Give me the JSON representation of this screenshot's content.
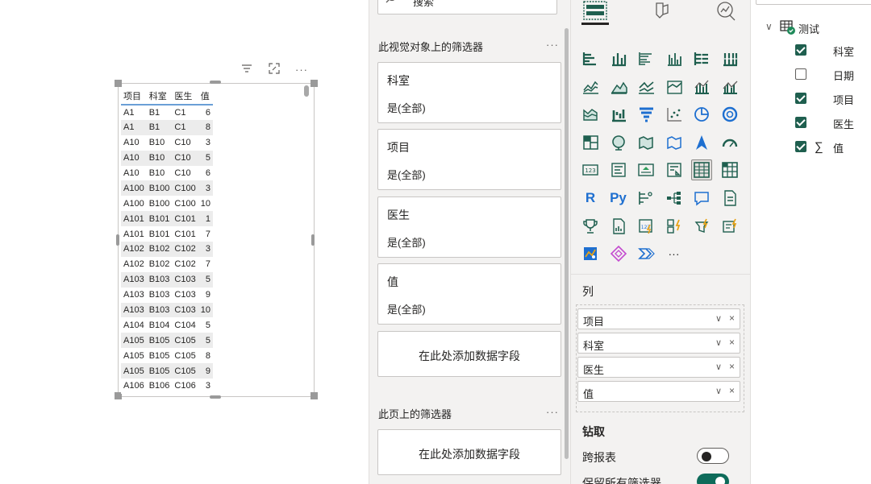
{
  "visual": {
    "columns": [
      "项目",
      "科室",
      "医生",
      "值"
    ],
    "rows": [
      [
        "A1",
        "B1",
        "C1",
        "6"
      ],
      [
        "A1",
        "B1",
        "C1",
        "8"
      ],
      [
        "A10",
        "B10",
        "C10",
        "3"
      ],
      [
        "A10",
        "B10",
        "C10",
        "5"
      ],
      [
        "A10",
        "B10",
        "C10",
        "6"
      ],
      [
        "A100",
        "B100",
        "C100",
        "3"
      ],
      [
        "A100",
        "B100",
        "C100",
        "10"
      ],
      [
        "A101",
        "B101",
        "C101",
        "1"
      ],
      [
        "A101",
        "B101",
        "C101",
        "7"
      ],
      [
        "A102",
        "B102",
        "C102",
        "3"
      ],
      [
        "A102",
        "B102",
        "C102",
        "7"
      ],
      [
        "A103",
        "B103",
        "C103",
        "5"
      ],
      [
        "A103",
        "B103",
        "C103",
        "9"
      ],
      [
        "A103",
        "B103",
        "C103",
        "10"
      ],
      [
        "A104",
        "B104",
        "C104",
        "5"
      ],
      [
        "A105",
        "B105",
        "C105",
        "5"
      ],
      [
        "A105",
        "B105",
        "C105",
        "8"
      ],
      [
        "A105",
        "B105",
        "C105",
        "9"
      ],
      [
        "A106",
        "B106",
        "C106",
        "3"
      ]
    ],
    "header_icons": {
      "filter": "filter-icon",
      "focus": "focus-mode-icon",
      "more": "···"
    }
  },
  "filters": {
    "search_placeholder": "搜索",
    "visual_section_title": "此视觉对象上的筛选器",
    "page_section_title": "此页上的筛选器",
    "more": "···",
    "cards": [
      {
        "title": "科室",
        "value": "是(全部)"
      },
      {
        "title": "项目",
        "value": "是(全部)"
      },
      {
        "title": "医生",
        "value": "是(全部)"
      },
      {
        "title": "值",
        "value": "是(全部)"
      }
    ],
    "add_field_label": "在此处添加数据字段"
  },
  "viz": {
    "more": "···",
    "text_icons": {
      "r": "R",
      "py": "Py"
    },
    "columns_label": "列",
    "fields": [
      "项目",
      "科室",
      "医生",
      "值"
    ],
    "drill_title": "钻取",
    "cross_report_label": "跨报表",
    "cross_report_on": false,
    "keep_filters_label": "保留所有筛选器",
    "keep_filters_on": true,
    "accent_color": "#0e6b5a"
  },
  "data_pane": {
    "table_name": "测试",
    "fields": [
      {
        "name": "科室",
        "checked": true,
        "sigma": ""
      },
      {
        "name": "日期",
        "checked": false,
        "sigma": ""
      },
      {
        "name": "项目",
        "checked": true,
        "sigma": ""
      },
      {
        "name": "医生",
        "checked": true,
        "sigma": ""
      },
      {
        "name": "值",
        "checked": true,
        "sigma": "∑"
      }
    ]
  }
}
